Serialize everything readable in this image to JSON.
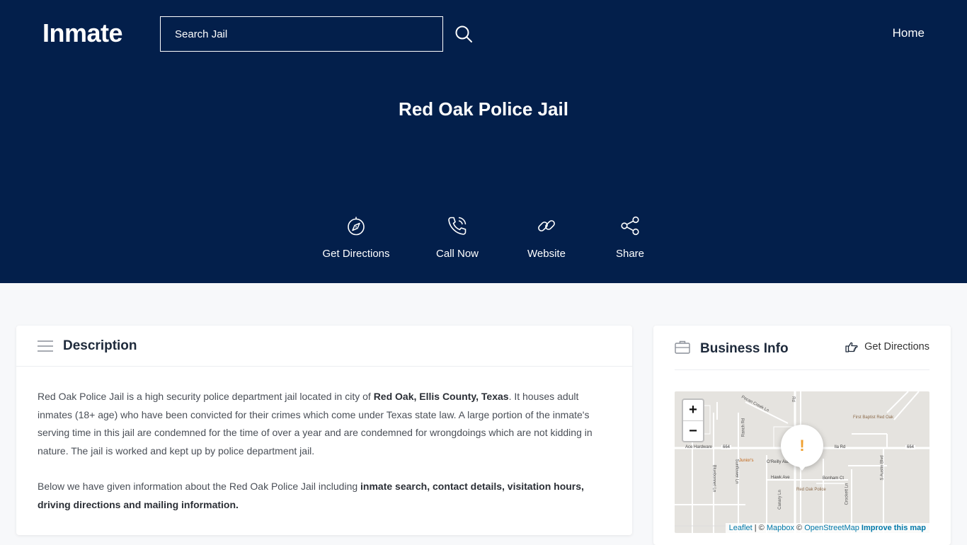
{
  "header": {
    "logo": "Inmate",
    "search_placeholder": "Search Jail",
    "nav_home": "Home"
  },
  "page": {
    "title": "Red Oak Police Jail"
  },
  "actions": [
    {
      "label": "Get Directions",
      "icon": "compass-icon"
    },
    {
      "label": "Call Now",
      "icon": "phone-icon"
    },
    {
      "label": "Website",
      "icon": "link-icon"
    },
    {
      "label": "Share",
      "icon": "share-icon"
    }
  ],
  "description": {
    "title": "Description",
    "p1_a": "Red Oak Police Jail is a high security police department jail located in city of ",
    "p1_b": "Red Oak, Ellis County, Texas",
    "p1_c": ". It houses adult inmates (18+ age) who have been convicted for their crimes which come under Texas state law. A large portion of the inmate's serving time in this jail are condemned for the time of over a year and are condemned for wrongdoings which are not kidding in nature. The jail is worked and kept up by police department jail.",
    "p2_a": "Below we have given information about the Red Oak Police Jail including ",
    "p2_b": "inmate search, contact details, visitation hours, driving directions and mailing information."
  },
  "business": {
    "title": "Business Info",
    "directions_label": "Get Directions",
    "map": {
      "zoom_in": "+",
      "zoom_out": "−",
      "marker": "!",
      "labels": {
        "first_baptist": "First Baptist Red Oak",
        "ace_hardware": "Ace Hardware",
        "juniors": "Junior's",
        "oreilly": "O'Reilly Auto",
        "hawk_ave": "Hawk Ave",
        "bonham_ct": "Bonham Ct",
        "red_oak_police": "Red Oak Police",
        "road_664a": "664",
        "road_664b": "664",
        "pecan_creek": "Pecan Creek Ln",
        "ranch_rd": "Ranch Rd",
        "crockett": "Crockett Ln",
        "austin_blvd": "S Austin Blvd",
        "sunflower": "Sunflower Ln",
        "bluebonnet": "Bluebonnet Ln",
        "canary": "Canary Ln",
        "ila_rd": "lla Rd"
      },
      "attr_leaflet": "Leaflet",
      "attr_sep1": " | © ",
      "attr_mapbox": "Mapbox",
      "attr_sep2": " © ",
      "attr_osm": "OpenStreetMap",
      "attr_improve": "Improve this map"
    }
  },
  "colors": {
    "hero_bg": "#031f4b",
    "marker": "#f0a030",
    "link": "#0078a8"
  }
}
